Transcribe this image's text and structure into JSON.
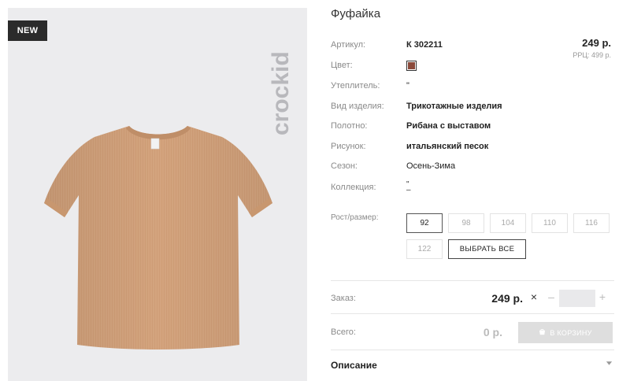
{
  "badge": {
    "new_label": "NEW"
  },
  "brand": {
    "logo_text": "crockid"
  },
  "product": {
    "title": "Фуфайка",
    "attributes": [
      {
        "label": "Артикул:",
        "value": "К 302211"
      },
      {
        "label": "Цвет:",
        "value": "",
        "swatch_color": "#8b4a3b"
      },
      {
        "label": "Утеплитель:",
        "value": "\""
      },
      {
        "label": "Вид изделия:",
        "value": "Трикотажные изделия"
      },
      {
        "label": "Полотно:",
        "value": "Рибана с выставом"
      },
      {
        "label": "Рисунок:",
        "value": "итальянский песок"
      },
      {
        "label": "Сезон:",
        "value": "Осень-Зима"
      },
      {
        "label": "Коллекция:",
        "value_line1": "\"",
        "value_line2": "–"
      }
    ],
    "price": "249 р.",
    "rrp": "РРЦ: 499 р."
  },
  "sizes": {
    "label": "Рост/размер:",
    "options": [
      "92",
      "98",
      "104",
      "110",
      "116",
      "122"
    ],
    "selected": "92",
    "select_all_label": "ВЫБРАТЬ ВСЕ"
  },
  "order": {
    "label": "Заказ:",
    "price": "249 р.",
    "multiply": "×",
    "minus": "–",
    "plus": "+",
    "quantity": ""
  },
  "total": {
    "label": "Всего:",
    "value": "0 р.",
    "cart_label": "В КОРЗИНУ"
  },
  "description": {
    "label": "Описание"
  },
  "colors": {
    "badge_bg": "#2b2b2b",
    "tshirt": "#d4a47e",
    "logo": "#b8b8bc",
    "cart_button": "#dedede"
  }
}
